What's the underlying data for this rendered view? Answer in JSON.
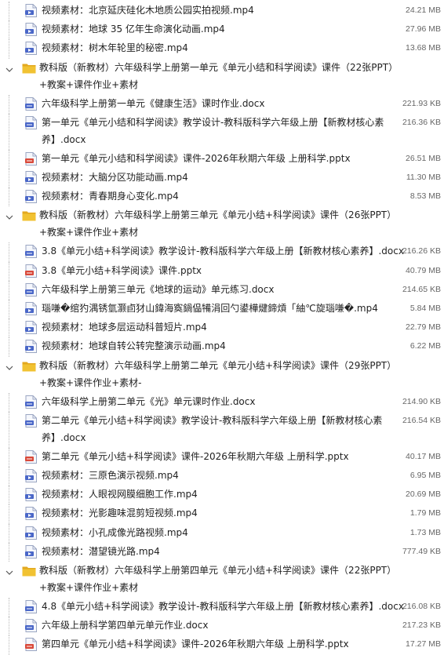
{
  "colors": {
    "accent": "#4a67c8",
    "pdf_red": "#d9493a",
    "folder": "#f1c232"
  },
  "rows": [
    {
      "type": "file",
      "icon": "video-icon",
      "name": "视频素材：北京延庆硅化木地质公园实拍视频.mp4",
      "size": "24.21 MB"
    },
    {
      "type": "file",
      "icon": "video-icon",
      "name": "视频素材：地球 35 亿年生命演化动画.mp4",
      "size": "27.96 MB"
    },
    {
      "type": "file",
      "icon": "video-icon",
      "name": "视频素材：树木年轮里的秘密.mp4",
      "size": "13.68 MB"
    },
    {
      "type": "folder",
      "name": "教科版（新教材）六年级科学上册第一单元《单元小结和科学阅读》课件（22张PPT）+教案+课件作业+素材"
    },
    {
      "type": "file",
      "icon": "word-icon",
      "name": "六年级科学上册第一单元《健康生活》课时作业.docx",
      "size": "221.93 KB"
    },
    {
      "type": "file",
      "icon": "word-icon",
      "name": "第一单元《单元小结和科学阅读》教学设计-教科版科学六年级上册【新教材核心素养】.docx",
      "size": "216.36 KB"
    },
    {
      "type": "file",
      "icon": "ppt-icon",
      "name": "第一单元《单元小结和科学阅读》课件-2026年秋期六年级 上册科学.pptx",
      "size": "26.51 MB"
    },
    {
      "type": "file",
      "icon": "video-icon",
      "name": "视频素材：大脑分区功能动画.mp4",
      "size": "11.30 MB"
    },
    {
      "type": "file",
      "icon": "video-icon",
      "name": "视频素材：青春期身心变化.mp4",
      "size": "8.53 MB"
    },
    {
      "type": "folder",
      "name": "教科版（新教材）六年级科学上册第三单元《单元小结+科学阅读》课件（26张PPT）+教案+课件作业+素材"
    },
    {
      "type": "file",
      "icon": "word-icon",
      "name": "3.8《单元小结+科学阅读》教学设计-教科版科学六年级上册【新教材核心素养】.docx",
      "size": "216.26 KB"
    },
    {
      "type": "file",
      "icon": "ppt-icon",
      "name": "3.8《单元小结+科学阅读》课件.pptx",
      "size": "40.79 MB"
    },
    {
      "type": "file",
      "icon": "word-icon",
      "name": "六年级科学上册第三单元《地球的运动》单元练习.docx",
      "size": "214.65 KB"
    },
    {
      "type": "file",
      "icon": "video-icon",
      "name": "瑙嗛&#xFFFD;绾犳湡锈氫灏卣犲山鍏海寏鍋偘犕涓回勺鍙樺煡鍗熕「紬℃旋瑙嗛&#xFFFD;.mp4",
      "size": "5.84 MB"
    },
    {
      "type": "file",
      "icon": "video-icon",
      "name": "视频素材：地球多层运动科普短片.mp4",
      "size": "22.79 MB"
    },
    {
      "type": "file",
      "icon": "video-icon",
      "name": "视频素材：地球自转公转完整演示动画.mp4",
      "size": "6.22 MB"
    },
    {
      "type": "folder",
      "name": "教科版（新教材）六年级科学上册第二单元《单元小结+科学阅读》课件（29张PPT）+教案+课件作业+素材-"
    },
    {
      "type": "file",
      "icon": "word-icon",
      "name": "六年级科学上册第二单元《光》单元课时作业.docx",
      "size": "214.90 KB"
    },
    {
      "type": "file",
      "icon": "word-icon",
      "name": "第二单元《单元小结+科学阅读》教学设计-教科版科学六年级上册【新教材核心素养】.docx",
      "size": "216.54 KB"
    },
    {
      "type": "file",
      "icon": "ppt-icon",
      "name": "第二单元《单元小结+科学阅读》课件-2026年秋期六年级 上册科学.pptx",
      "size": "40.17 MB"
    },
    {
      "type": "file",
      "icon": "video-icon",
      "name": "视频素材：三原色演示视频.mp4",
      "size": "6.95 MB"
    },
    {
      "type": "file",
      "icon": "video-icon",
      "name": "视频素材：人眼视网膜细胞工作.mp4",
      "size": "20.69 MB"
    },
    {
      "type": "file",
      "icon": "video-icon",
      "name": "视频素材：光影趣味混剪短视频.mp4",
      "size": "1.79 MB"
    },
    {
      "type": "file",
      "icon": "video-icon",
      "name": "视频素材：小孔成像光路视频.mp4",
      "size": "1.73 MB"
    },
    {
      "type": "file",
      "icon": "video-icon",
      "name": "视频素材：潜望镜光路.mp4",
      "size": "777.49 KB"
    },
    {
      "type": "folder",
      "name": "教科版（新教材）六年级科学上册第四单元《单元小结+科学阅读》课件（22张PPT）+教案+课件作业+素材"
    },
    {
      "type": "file",
      "icon": "word-icon",
      "name": "4.8《单元小结+科学阅读》教学设计-教科版科学六年级上册【新教材核心素养】.docx",
      "size": "216.08 KB"
    },
    {
      "type": "file",
      "icon": "word-icon",
      "name": "六年级上册科学第四单元单元作业.docx",
      "size": "217.23 KB"
    },
    {
      "type": "file",
      "icon": "ppt-icon",
      "name": "第四单元《单元小结+科学阅读》课件-2026年秋期六年级 上册科学.pptx",
      "size": "17.27 MB"
    }
  ]
}
